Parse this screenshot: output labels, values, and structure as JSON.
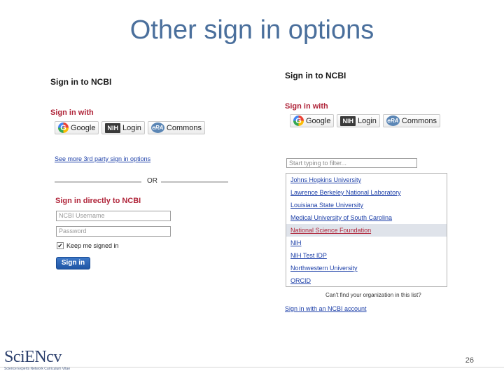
{
  "slide": {
    "title": "Other sign in options",
    "page_number": "26"
  },
  "logo": {
    "main": "SciENcv",
    "sub": "Science Experts Network Curriculum Vitae"
  },
  "left_panel": {
    "heading": "Sign in to NCBI",
    "sign_in_with": "Sign in with",
    "providers": [
      {
        "icon": "google-icon",
        "icon_text": "G",
        "label": "Google"
      },
      {
        "icon": "nih-icon",
        "icon_text": "NIH",
        "label": "Login"
      },
      {
        "icon": "era-commons-icon",
        "icon_text": "eRA",
        "label": "Commons"
      }
    ],
    "more_link": "See more 3rd party sign in options",
    "or_text": "OR",
    "direct_heading": "Sign in directly to NCBI",
    "username_placeholder": "NCBI Username",
    "password_placeholder": "Password",
    "keep_signed_in": "Keep me signed in",
    "keep_checked": true,
    "sign_in_button": "Sign in"
  },
  "right_panel": {
    "heading": "Sign in to NCBI",
    "sign_in_with": "Sign in with",
    "providers": [
      {
        "icon": "google-icon",
        "icon_text": "G",
        "label": "Google"
      },
      {
        "icon": "nih-icon",
        "icon_text": "NIH",
        "label": "Login"
      },
      {
        "icon": "era-commons-icon",
        "icon_text": "eRA",
        "label": "Commons"
      }
    ],
    "filter_placeholder": "Start typing to filter...",
    "institutions": [
      "Johns Hopkins University",
      "Lawrence Berkeley National Laboratory",
      "Louisiana State University",
      "Medical University of South Carolina",
      "National Science Foundation",
      "NIH",
      "NIH Test IDP",
      "Northwestern University",
      "ORCID"
    ],
    "selected_institution": "National Science Foundation",
    "cant_find": "Can't find your organization in this list?",
    "ncbi_account_link": "Sign in with an NCBI account"
  },
  "colors": {
    "title": "#4a6f9c",
    "accent_red": "#b0253a",
    "link_blue": "#1c3fa8",
    "button_blue": "#1f56a5"
  }
}
